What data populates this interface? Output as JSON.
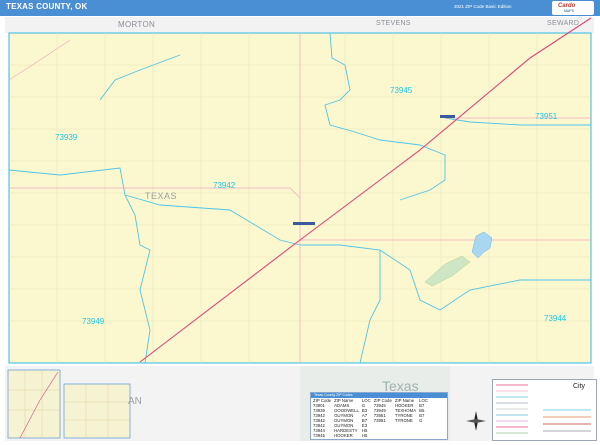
{
  "header": {
    "title": "TEXAS COUNTY, OK",
    "edition": "2021 ZIP Code Basic Edition",
    "logo_text": "Cardo",
    "logo_sub": "MAPS"
  },
  "map": {
    "neighbor_counties": [
      "MORTON",
      "STEVENS",
      "SEWARD"
    ],
    "county_label": "TEXAS",
    "bottom_label": "Texas",
    "inset_label": "AN",
    "zip_labels": [
      "73945",
      "73939",
      "73942",
      "73951",
      "73949",
      "73944"
    ]
  },
  "zip_table": {
    "header": "Texas County ZIP Codes",
    "columns": [
      "ZIP Code",
      "ZIP Name",
      "LOC",
      "ZIP Code",
      "ZIP Name",
      "LOC"
    ],
    "rows": [
      [
        "73901",
        "ADAMS",
        "G",
        "73945",
        "HOOKER",
        "B7"
      ],
      [
        "73939",
        "GOODWELL",
        "B3",
        "73949",
        "TEXHOMA",
        "B5"
      ],
      [
        "73942",
        "GUYMON",
        "A7",
        "73951",
        "TYRONE",
        "B7"
      ],
      [
        "73942",
        "GUYMON",
        "B7",
        "73951",
        "TYRONE",
        "G"
      ],
      [
        "73942",
        "GUYMON",
        "E3",
        "",
        "",
        ""
      ],
      [
        "73944",
        "HARDESTY",
        "H5",
        "",
        "",
        ""
      ],
      [
        "73945",
        "HOOKER",
        "H5",
        "",
        "",
        ""
      ]
    ]
  },
  "legend": {
    "label": "City"
  },
  "colors": {
    "header_bg": "#4a8fd4",
    "map_fill": "#fbf7cf",
    "zip_boundary": "#4fc4e8",
    "highway": "#e0457b",
    "road": "#f3a9c3"
  }
}
